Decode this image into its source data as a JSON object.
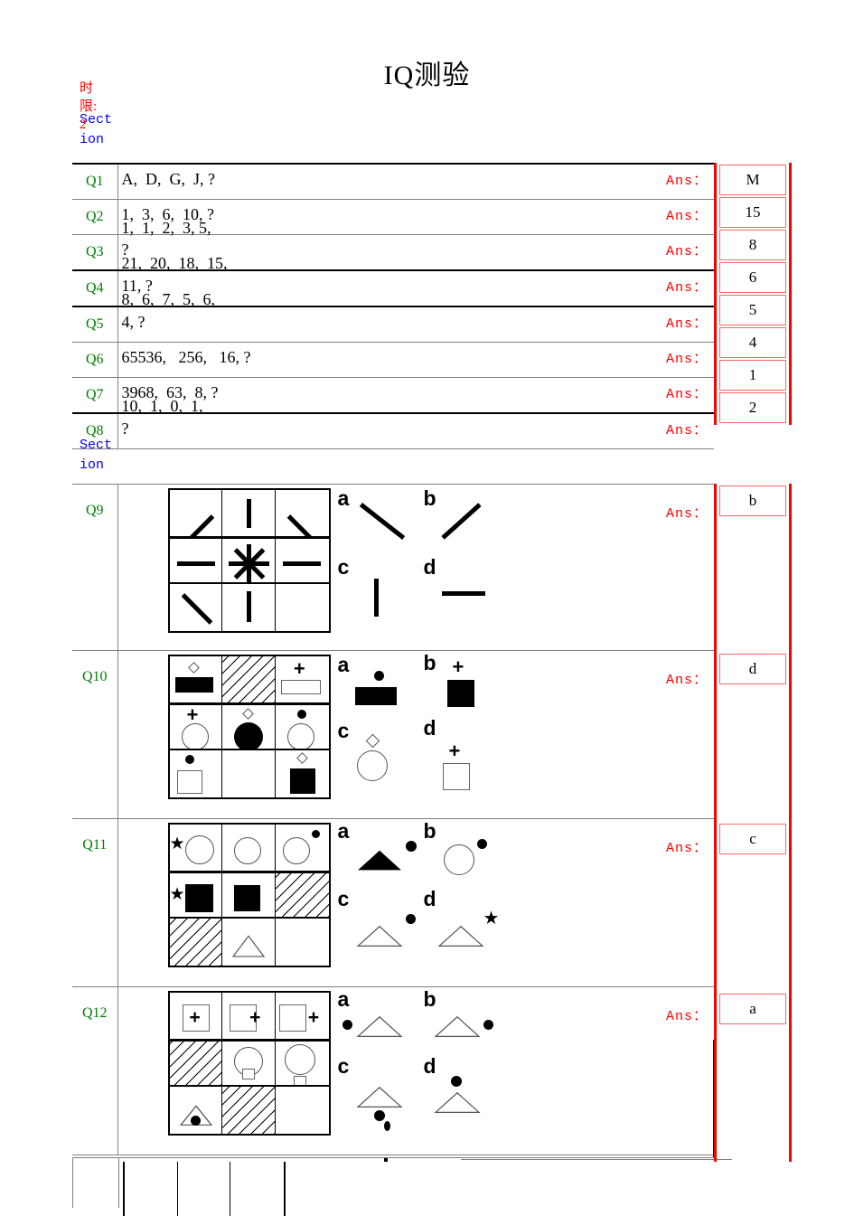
{
  "title": "IQ测验",
  "time_limit_note": "时限:2",
  "sections": [
    {
      "label": "Section"
    },
    {
      "label": "Section"
    }
  ],
  "ans_label": "Ans：",
  "section1": {
    "rows": [
      {
        "q": "Q1",
        "sequence": "A,  D,  G,  J, ?",
        "ghost": "",
        "ans": "M"
      },
      {
        "q": "Q2",
        "sequence": "1,  3,  6,  10, ?",
        "ghost": "1,  1,  2,  3, 5,",
        "ans": "15"
      },
      {
        "q": "Q3",
        "sequence": "?",
        "ghost": "21,  20,  18,  15,",
        "ans": "8"
      },
      {
        "q": "Q4",
        "sequence": "11, ?",
        "ghost": "8,  6,  7,  5,  6,",
        "ans": "6"
      },
      {
        "q": "Q5",
        "sequence": "4, ?",
        "ghost": "",
        "ans": "5"
      },
      {
        "q": "Q6",
        "sequence": "65536,   256,   16, ?",
        "ghost": "",
        "ans": "4"
      },
      {
        "q": "Q7",
        "sequence": "3968,  63,  8, ?",
        "ghost": "10,  1,  0,  1,",
        "ans": "1"
      },
      {
        "q": "Q8",
        "sequence": "?",
        "ghost": "",
        "ans": "2"
      }
    ]
  },
  "section2": {
    "rows": [
      {
        "q": "Q9",
        "ans": "b",
        "options": [
          "a",
          "b",
          "c",
          "d"
        ]
      },
      {
        "q": "Q10",
        "ans": "d",
        "options": [
          "a",
          "b",
          "c",
          "d"
        ]
      },
      {
        "q": "Q11",
        "ans": "c",
        "options": [
          "a",
          "b",
          "c",
          "d"
        ]
      },
      {
        "q": "Q12",
        "ans": "a",
        "options": [
          "a",
          "b",
          "c",
          "d"
        ]
      }
    ]
  },
  "colors": {
    "question_label": "#008000",
    "answer_label": "#ff0000",
    "section_label": "#0000ff",
    "time_note": "#ff0000",
    "answer_box_border": "#ff0000"
  }
}
